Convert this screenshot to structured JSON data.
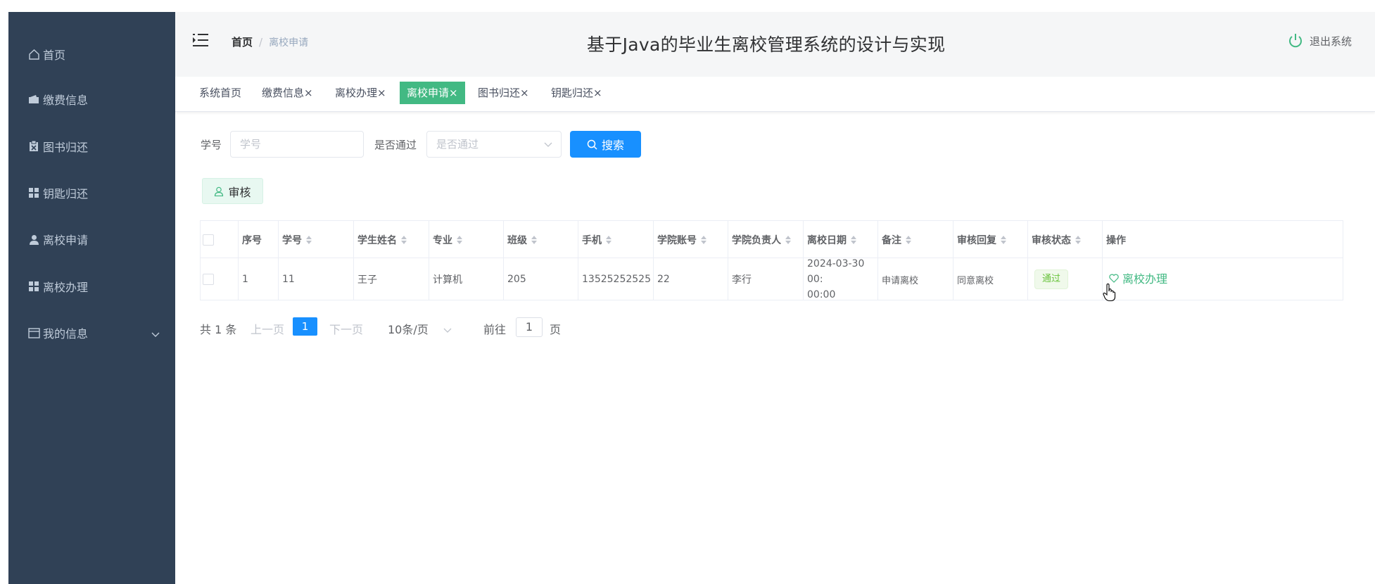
{
  "app": {
    "title": "基于Java的毕业生离校管理系统的设计与实现"
  },
  "sidebar": {
    "items": [
      {
        "label": "首页",
        "icon": "home-icon"
      },
      {
        "label": "缴费信息",
        "icon": "wallet-icon"
      },
      {
        "label": "图书归还",
        "icon": "clipboard-icon"
      },
      {
        "label": "钥匙归还",
        "icon": "grid-icon"
      },
      {
        "label": "离校申请",
        "icon": "user-icon"
      },
      {
        "label": "离校办理",
        "icon": "grid-icon"
      },
      {
        "label": "我的信息",
        "icon": "card-icon"
      }
    ],
    "bg_color": "#304156",
    "text_color": "#bfcbd9"
  },
  "header": {
    "breadcrumb_home": "首页",
    "breadcrumb_sep": "/",
    "breadcrumb_current": "离校申请",
    "logout_label": "退出系统"
  },
  "tags": [
    {
      "label": "系统首页"
    },
    {
      "label": "缴费信息×"
    },
    {
      "label": "离校办理×"
    },
    {
      "label": "离校申请×",
      "active": true
    },
    {
      "label": "图书归还×"
    },
    {
      "label": "钥匙归还×"
    }
  ],
  "search": {
    "xuehao_label": "学号",
    "xuehao_placeholder": "学号",
    "pass_label": "是否通过",
    "pass_placeholder": "是否通过",
    "search_button": "搜索",
    "audit_button": "审核"
  },
  "table": {
    "headers": [
      "序号",
      "学号",
      "学生姓名",
      "专业",
      "班级",
      "手机",
      "学院账号",
      "学院负责人",
      "离校日期",
      "备注",
      "审核回复",
      "审核状态",
      "操作"
    ],
    "rows": [
      {
        "index": "1",
        "xuehao": "11",
        "name": "王子",
        "major": "计算机",
        "class": "205",
        "phone": "13525252525",
        "college_account": "22",
        "college_leader": "李行",
        "date_line1": "2024-03-30 00:",
        "date_line2": "00:00",
        "note": "申请离校",
        "reply": "同意离校",
        "status": "通过",
        "action": "离校办理"
      }
    ]
  },
  "pagination": {
    "total": "共 1 条",
    "prev": "上一页",
    "current_page": "1",
    "next": "下一页",
    "page_size": "10条/页",
    "goto_label": "前往",
    "goto_value": "1",
    "page_unit": "页"
  },
  "colors": {
    "accent": "#42b983",
    "primary": "#1890ff",
    "success": "#67c23a"
  }
}
